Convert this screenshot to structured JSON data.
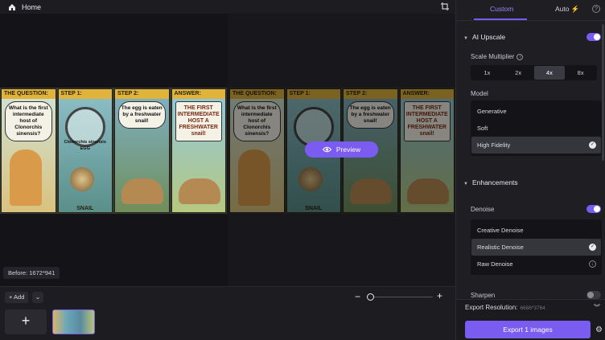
{
  "topbar": {
    "title": "Home"
  },
  "canvas": {
    "panels": [
      {
        "header": "THE QUESTION:",
        "text": "What is the first intermediate host of Clonorchis sinensis?",
        "bottom": ""
      },
      {
        "header": "STEP 1:",
        "text": "Clonorchis sinensis EGG",
        "bottom": "SNAIL"
      },
      {
        "header": "STEP 2:",
        "text": "The egg is eaten by a freshwater snail!",
        "bottom": ""
      },
      {
        "header": "ANSWER:",
        "text": "THE FIRST INTERMEDIATE HOST A FRESHWATER snail!",
        "bottom": ""
      }
    ],
    "preview_label": "Preview",
    "before_label": "Before: 1672*941"
  },
  "bottombar": {
    "add_label": "+ Add",
    "plus": "+"
  },
  "sidebar": {
    "tabs": {
      "custom": "Custom",
      "auto": "Auto",
      "help": "?"
    },
    "ai_upscale": {
      "title": "AI Upscale",
      "scale_label": "Scale Multiplier",
      "scales": [
        "1x",
        "2x",
        "4x",
        "8x"
      ],
      "selected_scale": "4x",
      "model_label": "Model",
      "models": [
        "Generative",
        "Soft",
        "High Fidelity"
      ],
      "selected_model": "High Fidelity"
    },
    "enhancements": {
      "title": "Enhancements",
      "denoise_label": "Denoise",
      "denoise_options": [
        "Creative Denoise",
        "Realistic Denoise",
        "Raw Denoise"
      ],
      "selected_denoise": "Realistic Denoise",
      "sharpen_label": "Sharpen"
    },
    "footer": {
      "export_res_label": "Export Resolution:",
      "export_res_value": "6688*3764",
      "export_button": "Export 1 images"
    }
  },
  "colors": {
    "accent": "#7a5cf0",
    "background": "#1a1a1f"
  }
}
